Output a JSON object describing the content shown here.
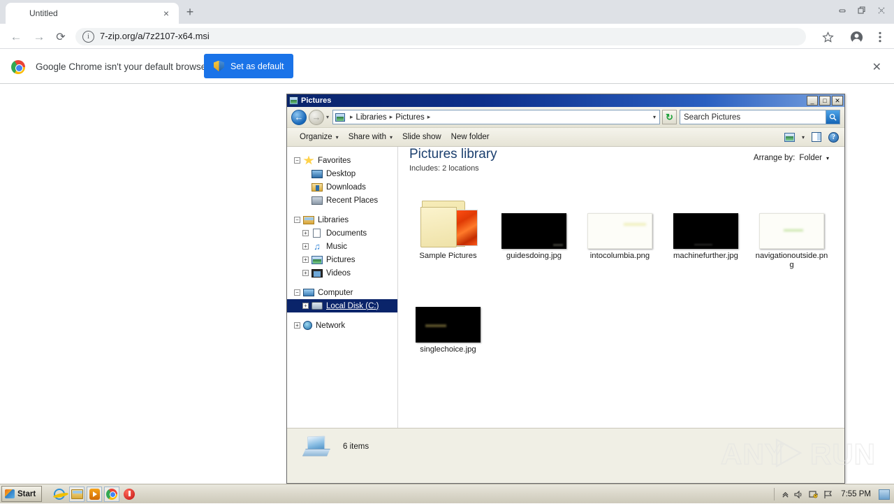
{
  "browser": {
    "tab": {
      "title": "Untitled",
      "close_label": "×"
    },
    "new_tab_label": "+",
    "nav": {
      "back": "←",
      "forward": "→",
      "reload": "⟳"
    },
    "omnibox": {
      "url": "7-zip.org/a/7z2107-x64.msi",
      "info_label": "i"
    },
    "infobar": {
      "message": "Google Chrome isn't your default browser",
      "button_label": "Set as default",
      "close_label": "✕"
    },
    "window_controls": {
      "minimize": "—",
      "restore": "❐",
      "close": "✕"
    }
  },
  "explorer": {
    "title": "Pictures",
    "window_controls": {
      "minimize": "_",
      "maximize": "□",
      "close": "✕"
    },
    "address": {
      "crumbs": [
        "Libraries",
        "Pictures"
      ],
      "separator": "▸",
      "dropdown": "▾",
      "refresh_label": "↻"
    },
    "search": {
      "placeholder": "Search Pictures",
      "go_label": "🔍"
    },
    "commandbar": {
      "items": [
        {
          "label": "Organize",
          "caret": "▾"
        },
        {
          "label": "Share with",
          "caret": "▾"
        },
        {
          "label": "Slide show",
          "caret": ""
        },
        {
          "label": "New folder",
          "caret": ""
        }
      ],
      "view_caret": "▾"
    },
    "nav_tree": [
      {
        "label": "Favorites",
        "expander": "−",
        "icon": "star-icon",
        "indent": 0,
        "selected": false
      },
      {
        "label": "Desktop",
        "expander": "",
        "icon": "desktop-icon",
        "indent": 1,
        "selected": false
      },
      {
        "label": "Downloads",
        "expander": "",
        "icon": "downloads-icon",
        "indent": 1,
        "selected": false
      },
      {
        "label": "Recent Places",
        "expander": "",
        "icon": "recent-places-icon",
        "indent": 1,
        "selected": false
      },
      {
        "label": "Libraries",
        "expander": "−",
        "icon": "libraries-icon",
        "indent": 0,
        "selected": false
      },
      {
        "label": "Documents",
        "expander": "+",
        "icon": "documents-icon",
        "indent": 1,
        "selected": false
      },
      {
        "label": "Music",
        "expander": "+",
        "icon": "music-icon",
        "indent": 1,
        "selected": false
      },
      {
        "label": "Pictures",
        "expander": "+",
        "icon": "pictures-icon",
        "indent": 1,
        "selected": false
      },
      {
        "label": "Videos",
        "expander": "+",
        "icon": "videos-icon",
        "indent": 1,
        "selected": false
      },
      {
        "label": "Computer",
        "expander": "−",
        "icon": "computer-icon",
        "indent": 0,
        "selected": false
      },
      {
        "label": "Local Disk (C:)",
        "expander": "+",
        "icon": "disk-icon",
        "indent": 1,
        "selected": true
      },
      {
        "label": "Network",
        "expander": "+",
        "icon": "network-icon",
        "indent": 0,
        "selected": false
      }
    ],
    "library": {
      "title": "Pictures library",
      "includes_label": "Includes:",
      "includes_value": "2 locations",
      "arrange_label": "Arrange by:",
      "arrange_value": "Folder",
      "arrange_caret": "▾"
    },
    "files": [
      {
        "name": "Sample Pictures",
        "kind": "folder"
      },
      {
        "name": "guidesdoing.jpg",
        "kind": "dark"
      },
      {
        "name": "intocolumbia.png",
        "kind": "light-yellow"
      },
      {
        "name": "machinefurther.jpg",
        "kind": "dark"
      },
      {
        "name": "navigationoutside.png",
        "kind": "light-green"
      },
      {
        "name": "singlechoice.jpg",
        "kind": "dark-text"
      }
    ],
    "status": {
      "text": "6 items"
    }
  },
  "watermark": {
    "left": "ANY",
    "right": "RUN"
  },
  "taskbar": {
    "start_label": "Start",
    "quick_launch": [
      {
        "name": "internet-explorer-icon"
      },
      {
        "name": "windows-explorer-icon"
      },
      {
        "name": "windows-media-player-icon"
      },
      {
        "name": "google-chrome-icon"
      },
      {
        "name": "shutdown-icon"
      }
    ],
    "tray": {
      "show_hidden": "«",
      "volume": "🔊",
      "action_center": "⚑",
      "flag": "⚐",
      "clock": "7:55 PM"
    }
  },
  "colors": {
    "chrome_tabstrip": "#dee1e6",
    "accent_blue": "#1a73e8",
    "explorer_titlebar": "#0a246a",
    "selection_blue": "#0a246a",
    "taskbar": "#dcd9cc"
  }
}
